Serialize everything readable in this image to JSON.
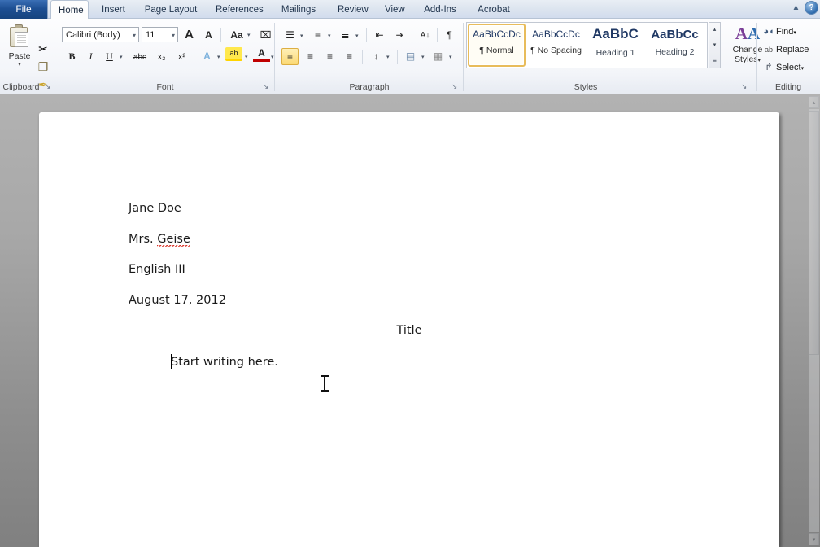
{
  "window": {
    "file_tab": "File",
    "tabs": [
      {
        "label": "Home",
        "active": true
      },
      {
        "label": "Insert",
        "active": false
      },
      {
        "label": "Page Layout",
        "active": false
      },
      {
        "label": "References",
        "active": false
      },
      {
        "label": "Mailings",
        "active": false
      },
      {
        "label": "Review",
        "active": false
      },
      {
        "label": "View",
        "active": false
      },
      {
        "label": "Add-Ins",
        "active": false
      },
      {
        "label": "Acrobat",
        "active": false
      }
    ],
    "minimize_ribbon_icon": "chevron-up-icon",
    "help_icon": "help-question-icon",
    "help_glyph": "?"
  },
  "ribbon": {
    "clipboard": {
      "label": "Clipboard",
      "paste_label": "Paste",
      "paste_arrow": "▾",
      "cut_icon": "scissors-icon",
      "cut_glyph": "✂",
      "copy_icon": "copy-icon",
      "copy_glyph": "❐",
      "format_painter_icon": "format-painter-icon",
      "format_painter_glyph": "✒",
      "dialog_launcher": "↘"
    },
    "font": {
      "label": "Font",
      "font_name": "Calibri (Body)",
      "font_size": "11",
      "grow_font": "A",
      "shrink_font": "A",
      "change_case": "Aa",
      "clear_formatting": "⌧",
      "bold": "B",
      "italic": "I",
      "underline": "U",
      "strikethrough": "abc",
      "subscript": "x₂",
      "superscript": "x²",
      "text_effects": "A",
      "highlight": "ab",
      "font_color": "A",
      "dropdown_arrow": "▾",
      "dialog_launcher": "↘"
    },
    "paragraph": {
      "label": "Paragraph",
      "bullets": "☰",
      "numbering": "≡",
      "multilevel": "≣",
      "decrease_indent": "⇤",
      "increase_indent": "⇥",
      "sort": "A↓",
      "show_marks": "¶",
      "align_left": "≡",
      "align_center": "≡",
      "align_right": "≡",
      "justify": "≡",
      "line_spacing": "↕",
      "shading": "▤",
      "borders": "▦",
      "dropdown_arrow": "▾",
      "dialog_launcher": "↘"
    },
    "styles": {
      "label": "Styles",
      "items": [
        {
          "sample": "AaBbCcDc",
          "name": "¶ Normal",
          "selected": true
        },
        {
          "sample": "AaBbCcDc",
          "name": "¶ No Spacing",
          "selected": false
        },
        {
          "sample": "AaBbC",
          "name": "Heading 1",
          "selected": false
        },
        {
          "sample": "AaBbCc",
          "name": "Heading 2",
          "selected": false
        }
      ],
      "scroll_up": "▴",
      "scroll_down": "▾",
      "more": "≡",
      "change_styles_icon": "change-styles-aa-icon",
      "change_styles_glyph": "AA",
      "change_styles_line1": "Change",
      "change_styles_line2": "Styles",
      "change_styles_arrow": "▾",
      "dialog_launcher": "↘"
    },
    "editing": {
      "label": "Editing",
      "find_label": "Find",
      "find_icon": "binoculars-icon",
      "find_glyph": "🔍",
      "replace_label": "Replace",
      "replace_icon": "replace-icon",
      "replace_glyph": "ab",
      "select_label": "Select",
      "select_icon": "cursor-arrow-icon",
      "select_glyph": "↱",
      "dropdown_arrow": "▾"
    }
  },
  "document": {
    "lines": [
      {
        "text": "Jane Doe",
        "align": "left"
      },
      {
        "text": "Mrs. ",
        "misspelled": "Geise",
        "align": "left"
      },
      {
        "text": "English III",
        "align": "left"
      },
      {
        "text": "August 17, 2012",
        "align": "left"
      },
      {
        "text": "Title",
        "align": "center"
      },
      {
        "text": "Start writing here.",
        "align": "indent"
      }
    ]
  },
  "scrollbar": {
    "up_arrow": "▴",
    "down_arrow": "▾"
  },
  "colors": {
    "file_tab_blue": "#1d4f93",
    "ribbon_bg": "#f3f5f9",
    "selected_gold": "#fbd974",
    "spellcheck_red": "#d93025",
    "doc_gray": "#a8a8a8",
    "style_blue": "#1f3864"
  }
}
